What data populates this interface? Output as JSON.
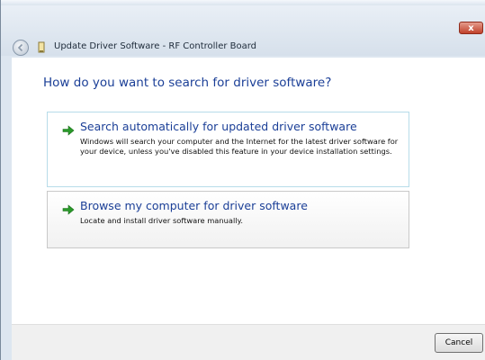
{
  "window": {
    "title": "Update Driver Software - RF Controller Board",
    "close_label": "x"
  },
  "main": {
    "heading": "How do you want to search for driver software?",
    "options": [
      {
        "title": "Search automatically for updated driver software",
        "description": "Windows will search your computer and the Internet for the latest driver software for your device, unless you've disabled this feature in your device installation settings."
      },
      {
        "title": "Browse my computer for driver software",
        "description": "Locate and install driver software manually."
      }
    ]
  },
  "footer": {
    "cancel_label": "Cancel"
  },
  "colors": {
    "accent_text": "#1b3f97",
    "arrow_green": "#2a9a2a",
    "close_red": "#c0412a"
  },
  "icons": {
    "back": "back-arrow-icon",
    "device": "device-icon",
    "option": "green-arrow-icon"
  }
}
